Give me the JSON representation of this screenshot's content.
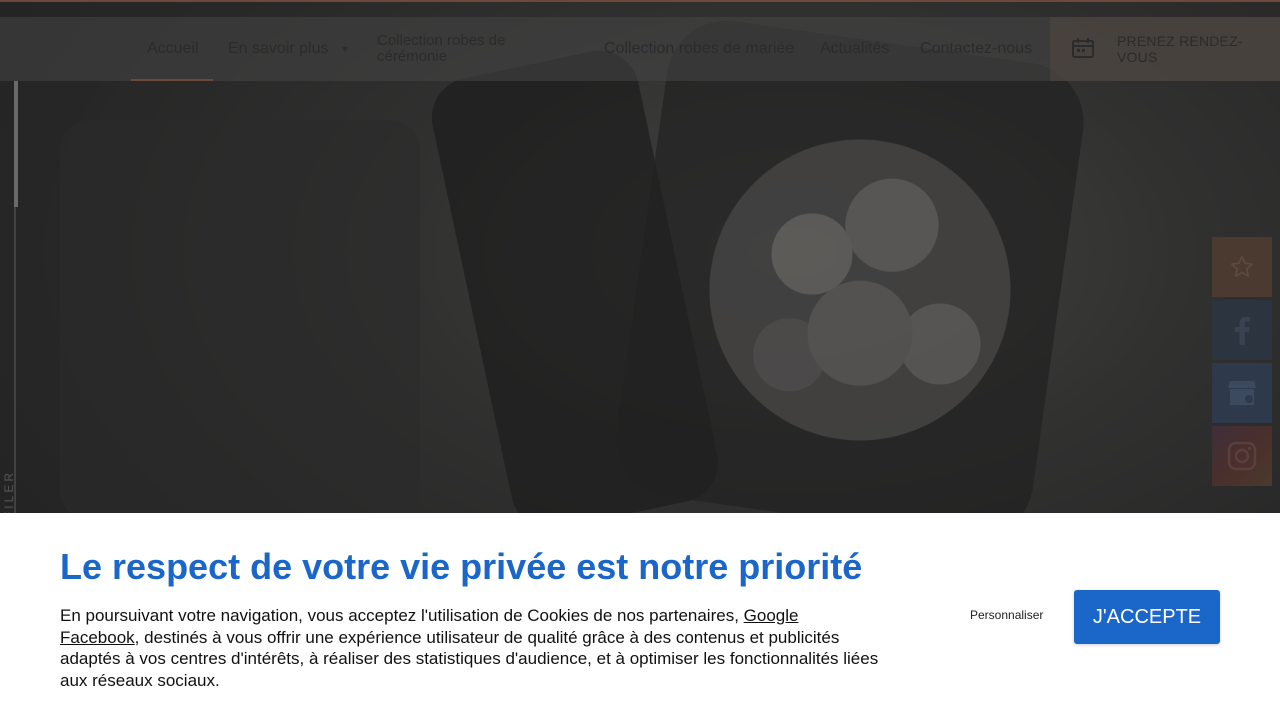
{
  "nav": {
    "items": [
      {
        "label": "Accueil"
      },
      {
        "label": "En savoir plus"
      },
      {
        "label": "Collection robes de cérémonie"
      },
      {
        "label": "Collection robes de mariée"
      },
      {
        "label": "Actualités"
      },
      {
        "label": "Contactez-nous"
      }
    ],
    "rdv_label": "PRENEZ RENDEZ-VOUS"
  },
  "scroll_text": "DÉFILER",
  "social": {
    "icons": [
      "star-icon",
      "facebook-icon",
      "google-my-business-icon",
      "instagram-icon"
    ]
  },
  "cookie": {
    "title": "Le respect de votre vie privée est notre priorité",
    "text_before": "En poursuivant votre navigation, vous acceptez l'utilisation de Cookies de nos partenaires, ",
    "link_google": "Google",
    "link_facebook": "Facebook",
    "text_after": ", destinés à vous offrir une expérience utilisateur de qualité grâce à des contenus et publicités adaptés à vos centres d'intérêts, à réaliser des statistiques d'audience, et à optimiser les fonctionnalités liées aux réseaux sociaux.",
    "customize_label": "Personnaliser",
    "accept_label": "J'ACCEPTE"
  },
  "colors": {
    "accent_blue": "#1b66c9",
    "brand_brown": "#6b4a3a"
  }
}
